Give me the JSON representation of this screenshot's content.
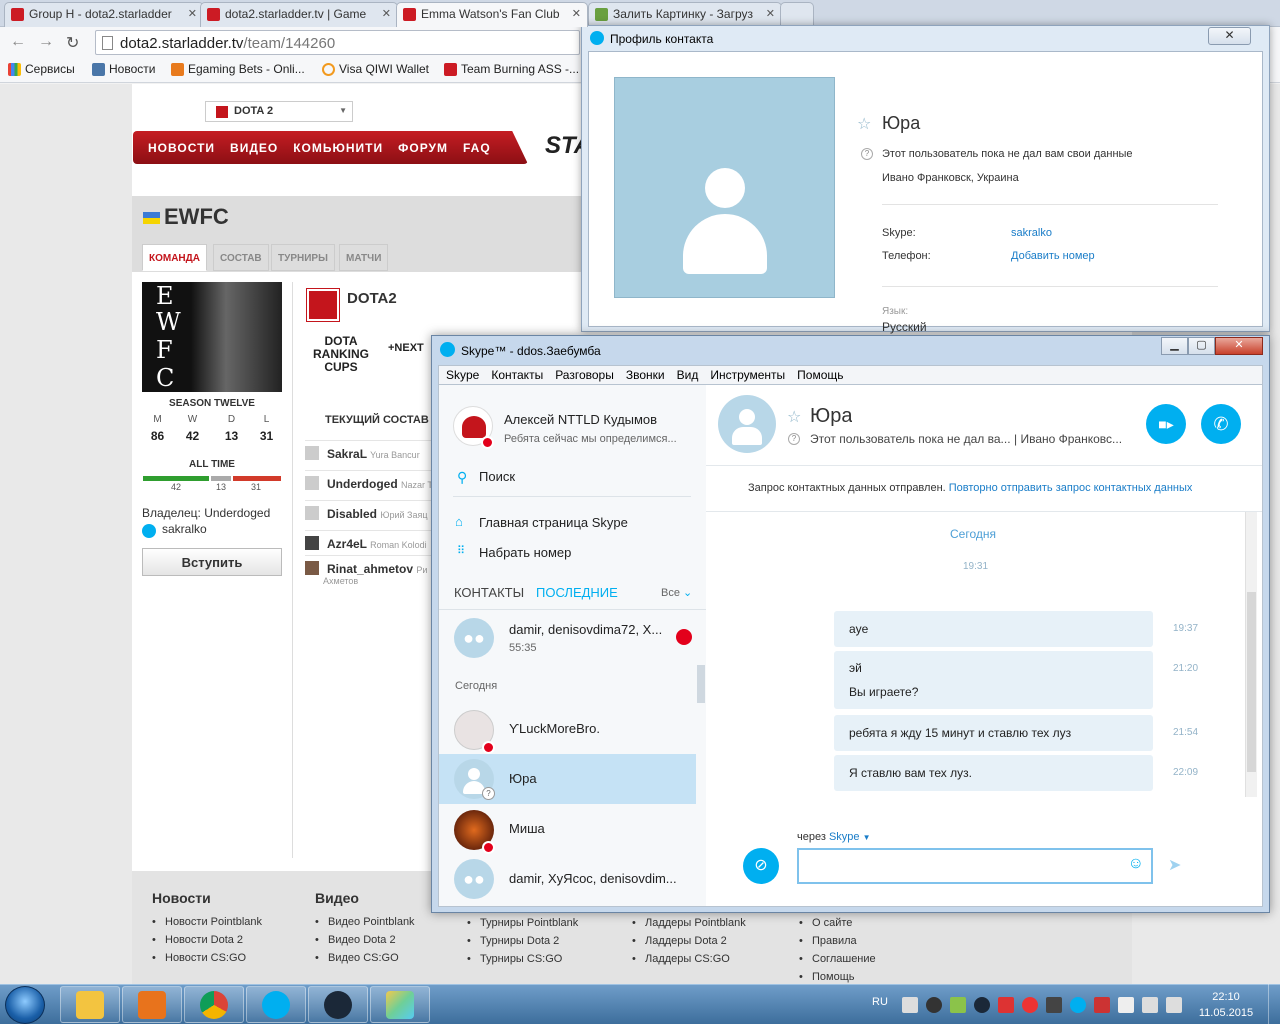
{
  "browser": {
    "tabs": [
      {
        "title": "Group H - dota2.starladder"
      },
      {
        "title": "dota2.starladder.tv | Game"
      },
      {
        "title": "Emma Watson's Fan Club"
      },
      {
        "title": "Залить Картинку - Загруз"
      }
    ],
    "url_host": "dota2.starladder.tv",
    "url_path": "/team/144260",
    "bookmarks": [
      "Сервисы",
      "Новости",
      "Egaming Bets - Onli...",
      "Visa QIWI Wallet",
      "Team Burning ASS -..."
    ]
  },
  "site": {
    "game_select": "DOTA 2",
    "nav": [
      "НОВОСТИ",
      "ВИДЕО",
      "КОМЬЮНИТИ",
      "ФОРУМ",
      "FAQ"
    ],
    "logo_text": "STA",
    "team_name": "EWFC",
    "team_tabs": [
      "КОМАНДА",
      "СОСТАВ",
      "ТУРНИРЫ",
      "МАТЧИ"
    ],
    "team_image_letters": [
      "E",
      "W",
      "F",
      "C"
    ],
    "season_title": "SEASON TWELVE",
    "season_stats": [
      {
        "label": "M",
        "value": "86"
      },
      {
        "label": "W",
        "value": "42"
      },
      {
        "label": "D",
        "value": "13"
      },
      {
        "label": "L",
        "value": "31"
      }
    ],
    "all_time_title": "ALL TIME",
    "all_time": {
      "win": "42",
      "draw": "13",
      "loss": "31"
    },
    "owner_label": "Владелец:",
    "owner_name": "Underdoged",
    "owner_skype": "sakralko",
    "join_button": "Вступить",
    "game_name": "DOTA2",
    "rank_cups": [
      "DOTA",
      "RANKING",
      "CUPS"
    ],
    "next_label": "+NEXT",
    "roster_title": "ТЕКУЩИЙ СОСТАВ",
    "players": [
      {
        "nick": "SakraL",
        "name": "Yura Bancur"
      },
      {
        "nick": "Underdoged",
        "name": "Nazar T"
      },
      {
        "nick": "Disabled",
        "name": "Юрий Заяц"
      },
      {
        "nick": "Azr4eL",
        "name": "Roman Kolodi"
      },
      {
        "nick": "Rinat_ahmetov",
        "name": "Ри",
        "name2": "Ахметов"
      }
    ],
    "footer": [
      {
        "title": "Новости",
        "items": [
          "Новости Pointblank",
          "Новости Dota 2",
          "Новости CS:GO"
        ]
      },
      {
        "title": "Видео",
        "items": [
          "Видео Pointblank",
          "Видео Dota 2",
          "Видео CS:GO"
        ]
      },
      {
        "title": "",
        "items": [
          "Турниры Pointblank",
          "Турниры Dota 2",
          "Турниры CS:GO"
        ]
      },
      {
        "title": "",
        "items": [
          "Ладдеры Pointblank",
          "Ладдеры Dota 2",
          "Ладдеры CS:GO"
        ]
      },
      {
        "title": "",
        "items": [
          "О сайте",
          "Правила",
          "Соглашение",
          "Помощь"
        ]
      }
    ]
  },
  "profile": {
    "window_title": "Профиль контакта",
    "close": "✕",
    "name": "Юра",
    "info": "Этот пользователь пока не дал вам свои данные",
    "location": "Ивано Франковск, Украина",
    "skype_label": "Skype:",
    "skype_value": "sakralko",
    "phone_label": "Телефон:",
    "phone_value": "Добавить номер",
    "lang_label": "Язык:",
    "lang_value": "Русский"
  },
  "skype": {
    "window_title": "Skype™ - ddos.3ae6ym6a",
    "window_title_display": "Skype™ - ddos.Заебумба",
    "menu": [
      "Skype",
      "Контакты",
      "Разговоры",
      "Звонки",
      "Вид",
      "Инструменты",
      "Помощь"
    ],
    "me_name": "Алексей NTTLD Кудымов",
    "me_status": "Ребята сейчас мы определимся...",
    "search": "Поиск",
    "home": "Главная страница Skype",
    "dial": "Набрать номер",
    "tab_contacts": "КОНТАКТЫ",
    "tab_recent": "ПОСЛЕДНИЕ",
    "filter": "Все",
    "recent_call": {
      "name": "damir, denisovdima72, X...",
      "time": "55:35"
    },
    "today_label": "Сегодня",
    "contacts": [
      {
        "name": "ϒLuckMoreBro."
      },
      {
        "name": "Юра"
      },
      {
        "name": "Миша"
      },
      {
        "name": "damir, XyЯcoc, denisovdim..."
      }
    ],
    "chat": {
      "name": "Юра",
      "status": "Этот пользователь пока не дал ва...",
      "location": "| Ивано Франковс...",
      "notice": "Запрос контактных данных отправлен.",
      "notice_link": "Повторно отправить запрос контактных данных",
      "day": "Сегодня",
      "day_time": "19:31",
      "messages": [
        {
          "text": "aye",
          "time": "19:37"
        },
        {
          "text": "эй",
          "text2": "Вы играете?",
          "time": "21:20"
        },
        {
          "text": "ребята я жду 15 минут и ставлю тех луз",
          "time": "21:54"
        },
        {
          "text": "Я ставлю вам тех луз.",
          "time": "22:09"
        }
      ],
      "via_label": "через",
      "via_value": "Skype"
    }
  },
  "taskbar": {
    "lang": "RU",
    "time": "22:10",
    "date": "11.05.2015"
  },
  "colors": {
    "skype_blue": "#00aff0",
    "starladder_red": "#c4151c",
    "selected_contact": "#c5e2f5"
  }
}
